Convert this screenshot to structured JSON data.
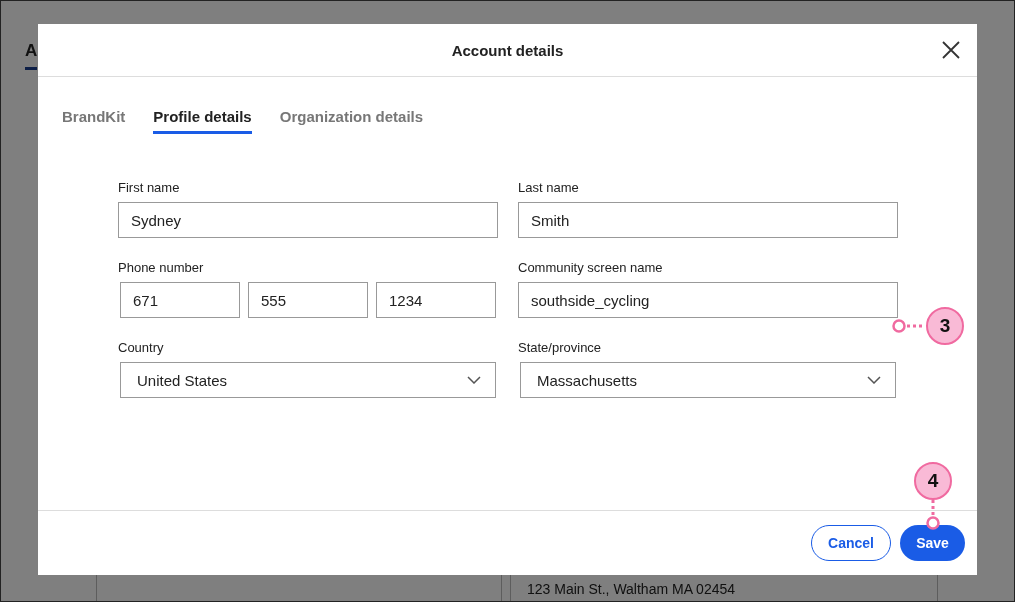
{
  "background": {
    "tab": "A",
    "address": "123 Main St., Waltham MA 02454"
  },
  "dialog": {
    "title": "Account details",
    "tabs": [
      {
        "label": "BrandKit",
        "selected": false
      },
      {
        "label": "Profile details",
        "selected": true
      },
      {
        "label": "Organization details",
        "selected": false
      }
    ],
    "fields": [
      {
        "kind": "text",
        "label": "First name",
        "value": "Sydney"
      },
      {
        "kind": "text",
        "label": "Last name",
        "value": "Smith"
      },
      {
        "kind": "phone",
        "label": "Phone number",
        "values": [
          "671",
          "555",
          "1234"
        ]
      },
      {
        "kind": "text",
        "label": "Community screen name",
        "value": "southside_cycling"
      },
      {
        "kind": "select",
        "label": "Country",
        "value": "United States"
      },
      {
        "kind": "select",
        "label": "State/province",
        "value": "Massachusetts"
      }
    ],
    "buttons": [
      {
        "label": "Cancel",
        "kind": "secondary"
      },
      {
        "label": "Save",
        "kind": "primary"
      }
    ]
  },
  "callouts": [
    {
      "label": "3",
      "kind": "left"
    },
    {
      "label": "4",
      "kind": "down"
    }
  ]
}
